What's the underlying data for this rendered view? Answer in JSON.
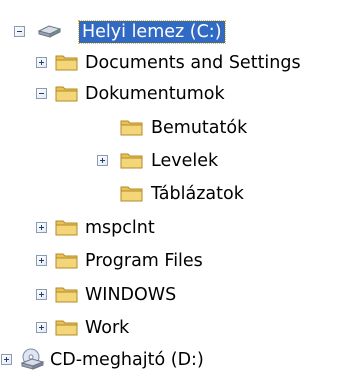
{
  "tree": {
    "drive_c": {
      "label": "Helyi lemez (C:)"
    },
    "documents_and_settings": {
      "label": "Documents and Settings"
    },
    "dokumentumok": {
      "label": "Dokumentumok"
    },
    "bemutatok": {
      "label": "Bemutatók"
    },
    "levelek": {
      "label": "Levelek"
    },
    "tablazatok": {
      "label": "Táblázatok"
    },
    "mspclnt": {
      "label": "mspclnt"
    },
    "program_files": {
      "label": "Program Files"
    },
    "windows": {
      "label": "WINDOWS"
    },
    "work": {
      "label": "Work"
    },
    "drive_d": {
      "label": "CD-meghajtó (D:)"
    }
  },
  "colors": {
    "selection_bg": "#316ac5",
    "selection_text": "#ffffff",
    "folder_yellow": "#f3d57a",
    "expander_border": "#8a9bb6"
  }
}
